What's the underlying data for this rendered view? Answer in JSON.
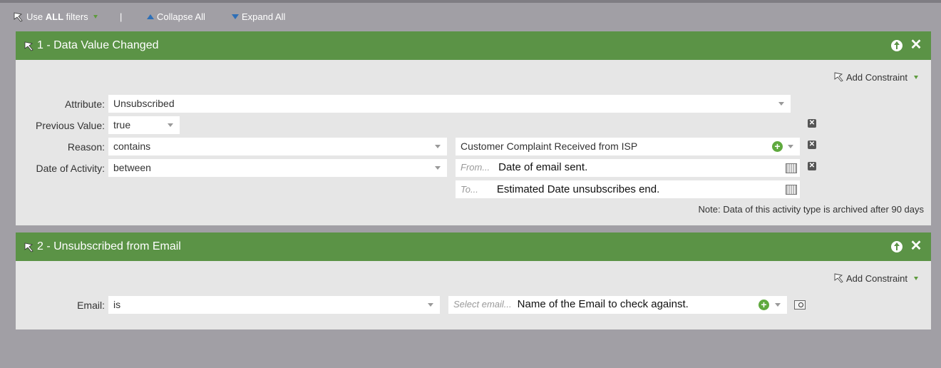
{
  "toolbar": {
    "use_prefix": "Use ",
    "use_bold": "ALL",
    "use_suffix": " filters",
    "separator": "|",
    "collapse_label": "Collapse All",
    "expand_label": "Expand All"
  },
  "filter1": {
    "title": "1 - Data Value Changed",
    "add_constraint": "Add Constraint",
    "rows": {
      "attribute": {
        "label": "Attribute:",
        "value": "Unsubscribed"
      },
      "previous": {
        "label": "Previous Value:",
        "value": "true"
      },
      "reason": {
        "label": "Reason:",
        "operator": "contains",
        "value": "Customer Complaint Received from ISP"
      },
      "date": {
        "label": "Date of Activity:",
        "operator": "between",
        "from_placeholder": "From...",
        "from_note": "Date of email sent.",
        "to_placeholder": "To...",
        "to_note": "Estimated Date unsubscribes end."
      }
    },
    "note": "Note: Data of this activity type is archived after 90 days"
  },
  "filter2": {
    "title": "2 - Unsubscribed from Email",
    "add_constraint": "Add Constraint",
    "email": {
      "label": "Email:",
      "operator": "is",
      "placeholder": "Select email...",
      "note": "Name of the Email to check against."
    }
  },
  "icons": {
    "header_icon": "filter-wrench-icon",
    "move_up": "arrow-up-circle-icon",
    "remove": "close-icon",
    "add": "plus-circle-icon",
    "calendar": "calendar-icon",
    "delete_row": "delete-row-icon",
    "browse": "browse-icon"
  },
  "colors": {
    "header_green": "#5b9346",
    "panel_bg": "#e6e6e6",
    "page_bg": "#a19fa5",
    "toolbar_arrow_blue": "#2e6fb7",
    "add_green": "#5fa93e"
  }
}
